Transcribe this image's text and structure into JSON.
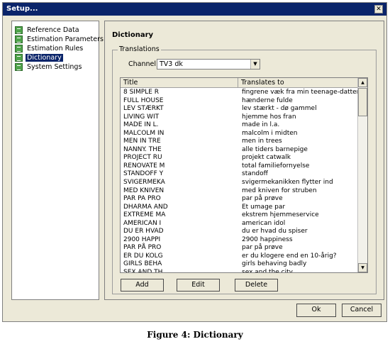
{
  "window": {
    "title": "Setup...",
    "close_glyph": "✕"
  },
  "sidebar": {
    "items": [
      {
        "label": "Reference Data",
        "icon": "table-icon"
      },
      {
        "label": "Estimation Parameters",
        "icon": "table-icon"
      },
      {
        "label": "Estimation Rules",
        "icon": "table-icon"
      },
      {
        "label": "Dictionary",
        "icon": "table-icon",
        "selected": true
      },
      {
        "label": "System Settings",
        "icon": "table-icon"
      }
    ]
  },
  "content": {
    "heading": "Dictionary",
    "group_label": "Translations",
    "channel_label": "Channel:",
    "channel_value": "TV3 dk",
    "columns": [
      "Title",
      "Translates to"
    ],
    "rows": [
      [
        "8 SIMPLE R",
        "fingrene væk fra min teenage-datter"
      ],
      [
        "FULL HOUSE",
        "hænderne fulde"
      ],
      [
        "LEV STÆRKT",
        "lev stærkt - dø gammel"
      ],
      [
        "LIVING WIT",
        "hjemme hos fran"
      ],
      [
        "MADE IN L.",
        "made in l.a."
      ],
      [
        "MALCOLM IN",
        "malcolm i midten"
      ],
      [
        "MEN IN TRE",
        "men in trees"
      ],
      [
        "NANNY. THE",
        "alle tiders barnepige"
      ],
      [
        "PROJECT RU",
        "projekt catwalk"
      ],
      [
        "RENOVATE M",
        "total familieforny​else"
      ],
      [
        "STANDOFF Y",
        "standoff"
      ],
      [
        "SVIGERMEKA",
        "svigermekanikken flytter ind"
      ],
      [
        "MED KNIVEN",
        "med kniven for struben"
      ],
      [
        "PAR PA PRO",
        "par på prøve"
      ],
      [
        "DHARMA AND",
        "Et umage par"
      ],
      [
        "EXTREME MA",
        "ekstrem hjemmeservice"
      ],
      [
        "AMERICAN I",
        "american idol"
      ],
      [
        "DU ER HVAD",
        "du er hvad du spiser"
      ],
      [
        "2900 HAPPI",
        "2900 happiness"
      ],
      [
        "PAR PÅ PRO",
        "par på prøve"
      ],
      [
        "ER DU KOLG",
        "er du klogere end en 10-årig?"
      ],
      [
        "GIRLS BEHA",
        "girls behaving badly"
      ],
      [
        "SEX AND TH",
        "sex and the city"
      ]
    ],
    "buttons": {
      "add": "Add",
      "edit": "Edit",
      "delete": "Delete"
    }
  },
  "footer": {
    "ok": "Ok",
    "cancel": "Cancel"
  },
  "caption": "Figure 4: Dictionary",
  "colors": {
    "title_bar": "#0a246a",
    "dialog_bg": "#ece9d8",
    "selection": "#0a246a"
  }
}
